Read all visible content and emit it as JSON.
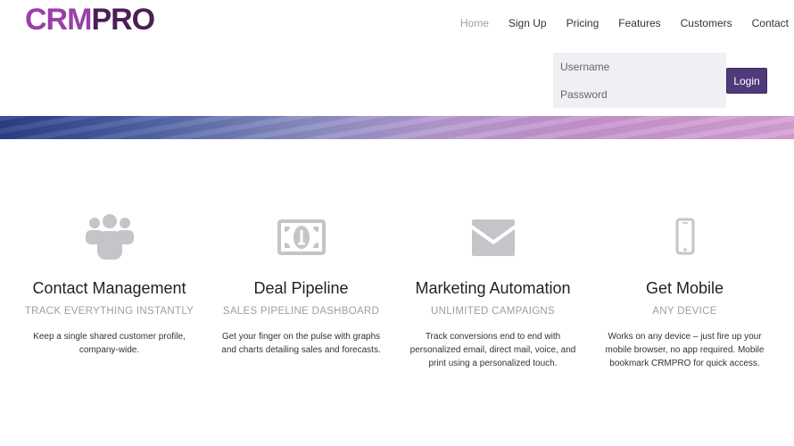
{
  "brand": {
    "part1": "CRM",
    "part2": "PRO"
  },
  "nav": {
    "items": [
      "Home",
      "Sign Up",
      "Pricing",
      "Features",
      "Customers",
      "Contact"
    ]
  },
  "login": {
    "username_placeholder": "Username",
    "password_placeholder": "Password",
    "button_label": "Login"
  },
  "features": [
    {
      "icon": "users-icon",
      "title": "Contact Management",
      "subtitle": "TRACK EVERYTHING INSTANTLY",
      "description": "Keep a single shared customer profile, company-wide."
    },
    {
      "icon": "money-icon",
      "title": "Deal Pipeline",
      "subtitle": "SALES PIPELINE DASHBOARD",
      "description": "Get your finger on the pulse with graphs and charts detailing sales and forecasts."
    },
    {
      "icon": "envelope-icon",
      "title": "Marketing Automation",
      "subtitle": "UNLIMITED CAMPAIGNS",
      "description": "Track conversions end to end with personalized email, direct mail, voice, and print using a personalized touch."
    },
    {
      "icon": "mobile-icon",
      "title": "Get Mobile",
      "subtitle": "ANY DEVICE",
      "description": "Works on any device – just fire up your mobile browser, no app required. Mobile bookmark CRMPRO for quick access."
    }
  ],
  "colors": {
    "brand_light": "#9a3fa8",
    "brand_dark": "#4b1f55",
    "button": "#513a7a",
    "icon_gray": "#c4c5c8"
  }
}
